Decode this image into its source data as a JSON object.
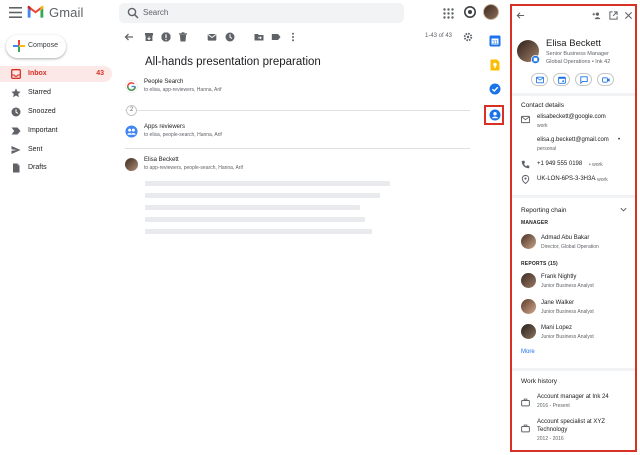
{
  "app": {
    "brand": "Gmail",
    "search_placeholder": "Search",
    "compose_label": "Compose"
  },
  "colors": {
    "gmail_red": "#d93025",
    "link_blue": "#1a73e8",
    "calendar_blue": "#1a73e8",
    "keep_yellow": "#fbbc04",
    "tasks_blue": "#1a73e8"
  },
  "nav": [
    {
      "label": "Inbox",
      "count": "43",
      "icon": "inbox-icon",
      "active": true
    },
    {
      "label": "Starred",
      "count": "",
      "icon": "star-icon",
      "active": false
    },
    {
      "label": "Snoozed",
      "count": "",
      "icon": "clock-icon",
      "active": false
    },
    {
      "label": "Important",
      "count": "",
      "icon": "important-icon",
      "active": false
    },
    {
      "label": "Sent",
      "count": "",
      "icon": "send-icon",
      "active": false
    },
    {
      "label": "Drafts",
      "count": "",
      "icon": "draft-icon",
      "active": false
    }
  ],
  "toolbar": {
    "pager": "1-43 of 43",
    "icons": [
      "back-arrow-icon",
      "archive-icon",
      "report-icon",
      "delete-icon",
      "mark-unread-icon",
      "snooze-icon",
      "move-to-icon",
      "label-icon",
      "more-vert-icon"
    ]
  },
  "thread": {
    "subject": "All-hands presentation preparation",
    "collapsed_count": "2",
    "messages": [
      {
        "sender": "People Search",
        "to": "to elisa, app-reviewers, Hanna, Arif"
      },
      {
        "sender": "Apps reviewers",
        "to": "to elisa, people-search, Hanna, Arif"
      },
      {
        "sender": "Elisa Beckett",
        "to": "to app-reviewers, people-search, Hanna, Arif"
      }
    ]
  },
  "contact": {
    "name": "Elisa Beckett",
    "title": "Senior Business Manager",
    "org": "Global Operations • Ink 42",
    "details_heading": "Contact details",
    "emails": [
      {
        "value": "elisabeckett@google.com",
        "type": "work"
      },
      {
        "value": "elisa.g.beckett@gmail.com",
        "type": "personal"
      }
    ],
    "phone": {
      "value": "+1 949 555 0198",
      "type": "work"
    },
    "location": {
      "value": "UK-LON-6PS-3-3H3A",
      "type": "work"
    },
    "reporting_heading": "Reporting chain",
    "manager_label": "MANAGER",
    "manager": {
      "name": "Admad Abu Bakar",
      "title": "Director, Global Operation"
    },
    "reports_label": "REPORTS (15)",
    "reports": [
      {
        "name": "Frank Nightly",
        "title": "Junior Business Analyst"
      },
      {
        "name": "Jane Walker",
        "title": "Junior Business Analyst"
      },
      {
        "name": "Mani Lopez",
        "title": "Junior Business Analyst"
      }
    ],
    "more_label": "More",
    "history_heading": "Work history",
    "history": [
      {
        "role_l1": "Account manager at Ink 24",
        "role_l2": "",
        "dates": "2016 - Present"
      },
      {
        "role_l1": "Account specialist at XYZ",
        "role_l2": "Technology",
        "dates": "2012 - 2016"
      }
    ]
  }
}
